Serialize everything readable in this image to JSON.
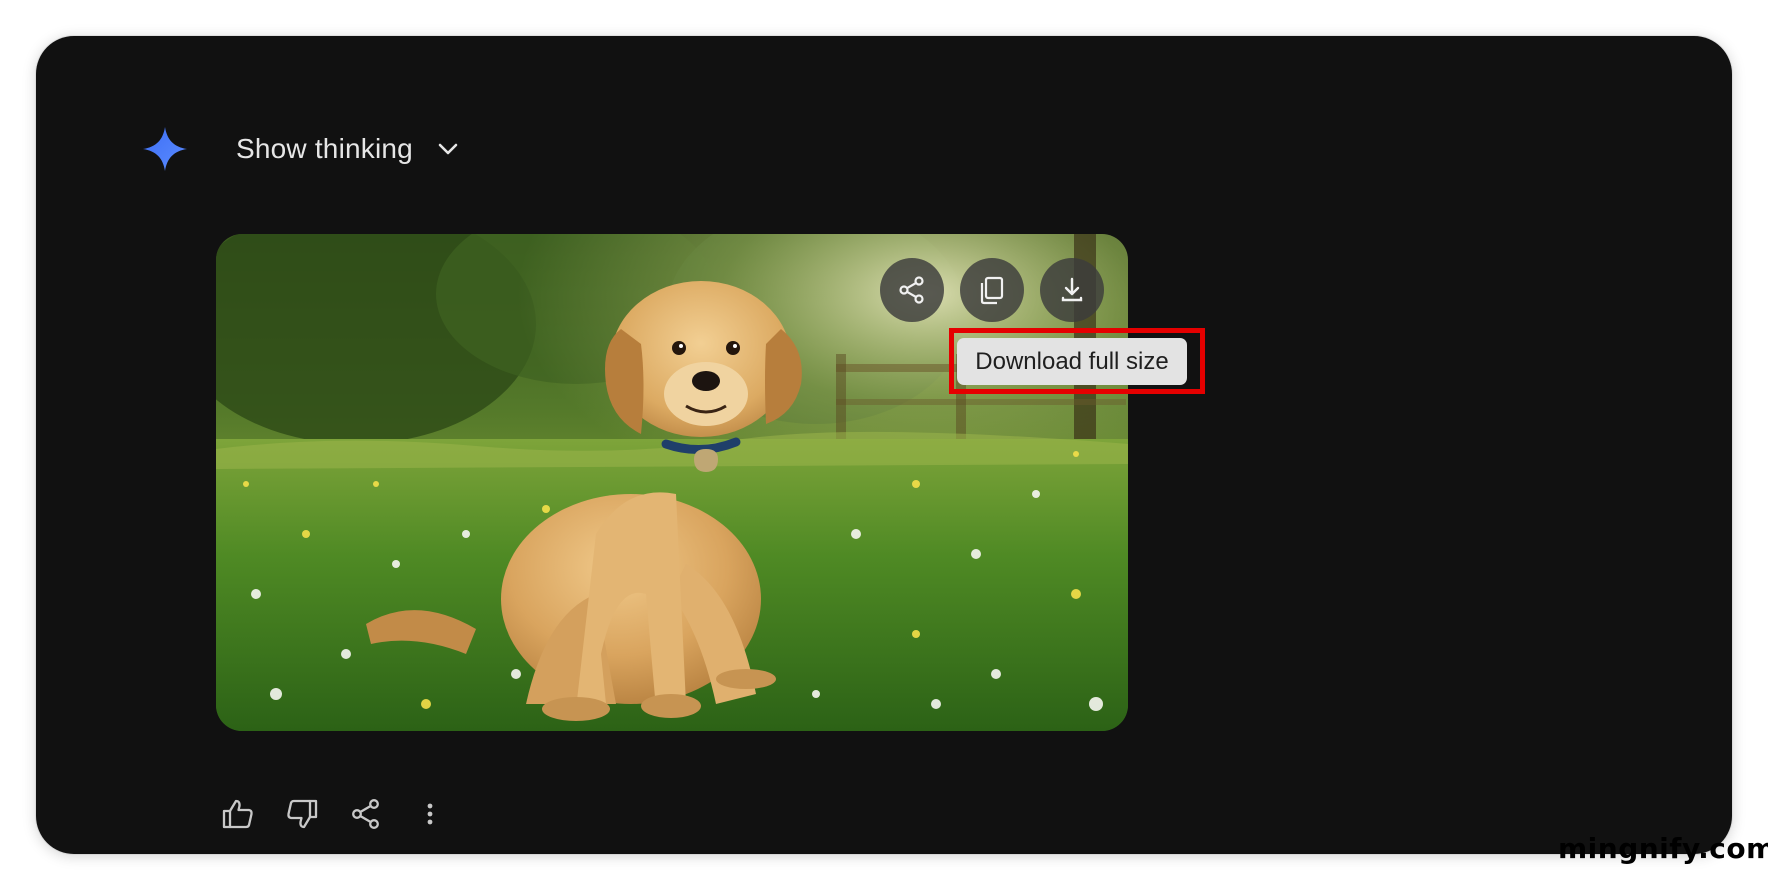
{
  "header": {
    "show_thinking_label": "Show thinking"
  },
  "image": {
    "subject": "golden retriever puppy sitting in grassy meadow with daisies",
    "buttons": {
      "share_icon": "share-icon",
      "copy_icon": "copy-icon",
      "download_icon": "download-icon"
    },
    "tooltip": "Download full size"
  },
  "actions": {
    "icons": [
      "thumbs-up-icon",
      "thumbs-down-icon",
      "share-icon",
      "more-vert-icon"
    ]
  },
  "watermark": "mingnify.com",
  "colors": {
    "background": "#111111",
    "gem_blue": "#4a7bf7",
    "tooltip_bg": "#e3e3e3",
    "highlight_red": "#e50000"
  }
}
